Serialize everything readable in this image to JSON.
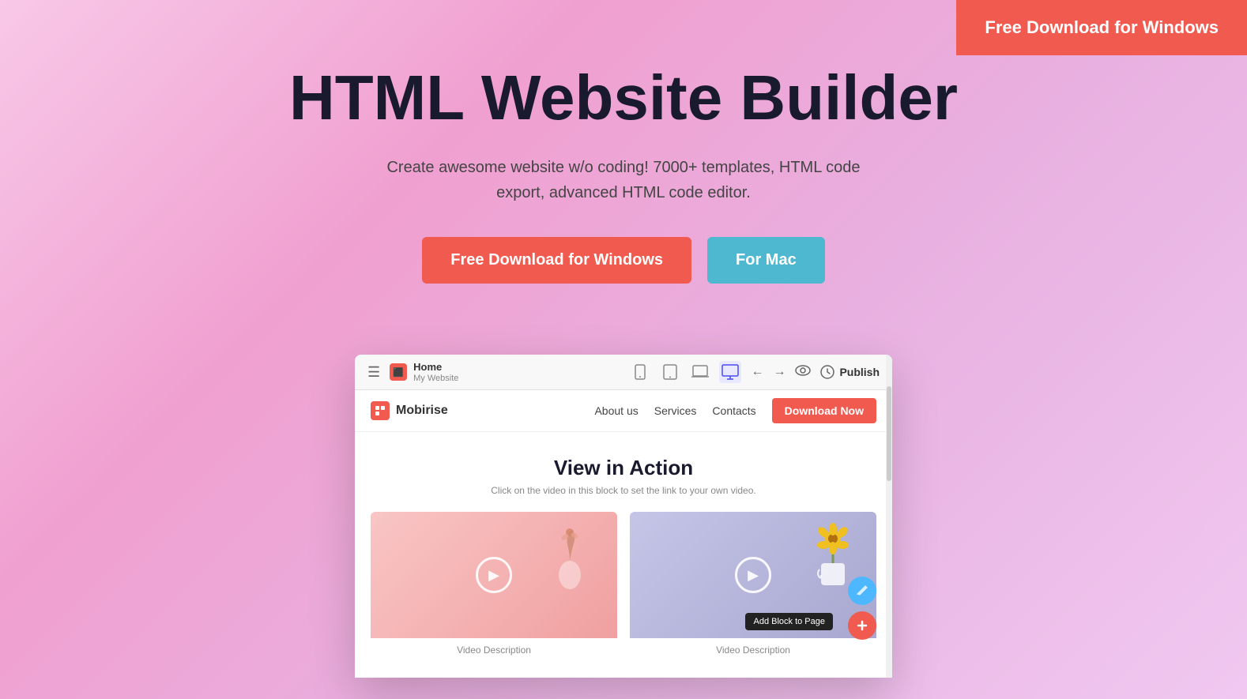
{
  "topCta": {
    "label": "Free Download for Windows"
  },
  "hero": {
    "title": "HTML Website Builder",
    "subtitle": "Create awesome website w/o coding! 7000+ templates, HTML code export, advanced HTML code editor.",
    "btn_windows": "Free Download for Windows",
    "btn_mac": "For Mac"
  },
  "mockup": {
    "toolbar": {
      "menu_icon": "☰",
      "page_name": "Home",
      "page_sub": "My Website",
      "device_icons": [
        "📱",
        "⬜",
        "⬛",
        "🖥"
      ],
      "back_label": "←",
      "forward_label": "→",
      "preview_label": "👁",
      "publish_label": "Publish"
    },
    "nav": {
      "logo": "Mobirise",
      "links": [
        "About us",
        "Services",
        "Contacts"
      ],
      "cta": "Download Now"
    },
    "section": {
      "title": "View in Action",
      "subtitle": "Click on the video in this block to set the link to your own video.",
      "videos": [
        {
          "desc": "Video Description"
        },
        {
          "desc": "Video Description"
        }
      ]
    },
    "floating": {
      "add_block": "Add Block to Page"
    }
  }
}
